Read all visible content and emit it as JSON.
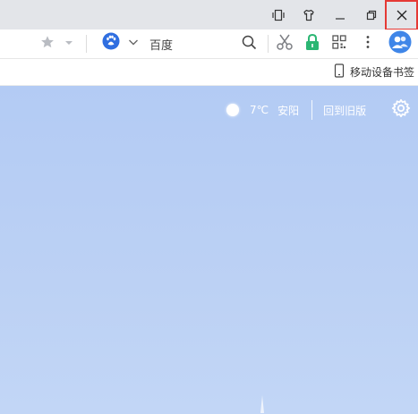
{
  "colors": {
    "close_highlight": "#e53935",
    "content_bg": "#b8cef4",
    "lock_green": "#2bb673",
    "baidu_blue": "#2f6ee0",
    "avatar_blue": "#3f86e8"
  },
  "titlebar": {
    "icons": [
      "tablet-mode-icon",
      "skin-shirt-icon",
      "minimize-icon",
      "restore-icon",
      "close-icon"
    ]
  },
  "toolbar": {
    "search_engine": "百度",
    "icons": [
      "star-icon",
      "chevron-down-icon",
      "baidu-paw-icon",
      "search-icon",
      "scissors-icon",
      "lock-icon",
      "qrcode-icon",
      "more-vertical-icon",
      "avatar-icon"
    ]
  },
  "bookmarks": {
    "mobile_label": "移动设备书签"
  },
  "content": {
    "weather": {
      "temperature": "7℃",
      "city": "安阳"
    },
    "old_version_link": "回到旧版"
  }
}
